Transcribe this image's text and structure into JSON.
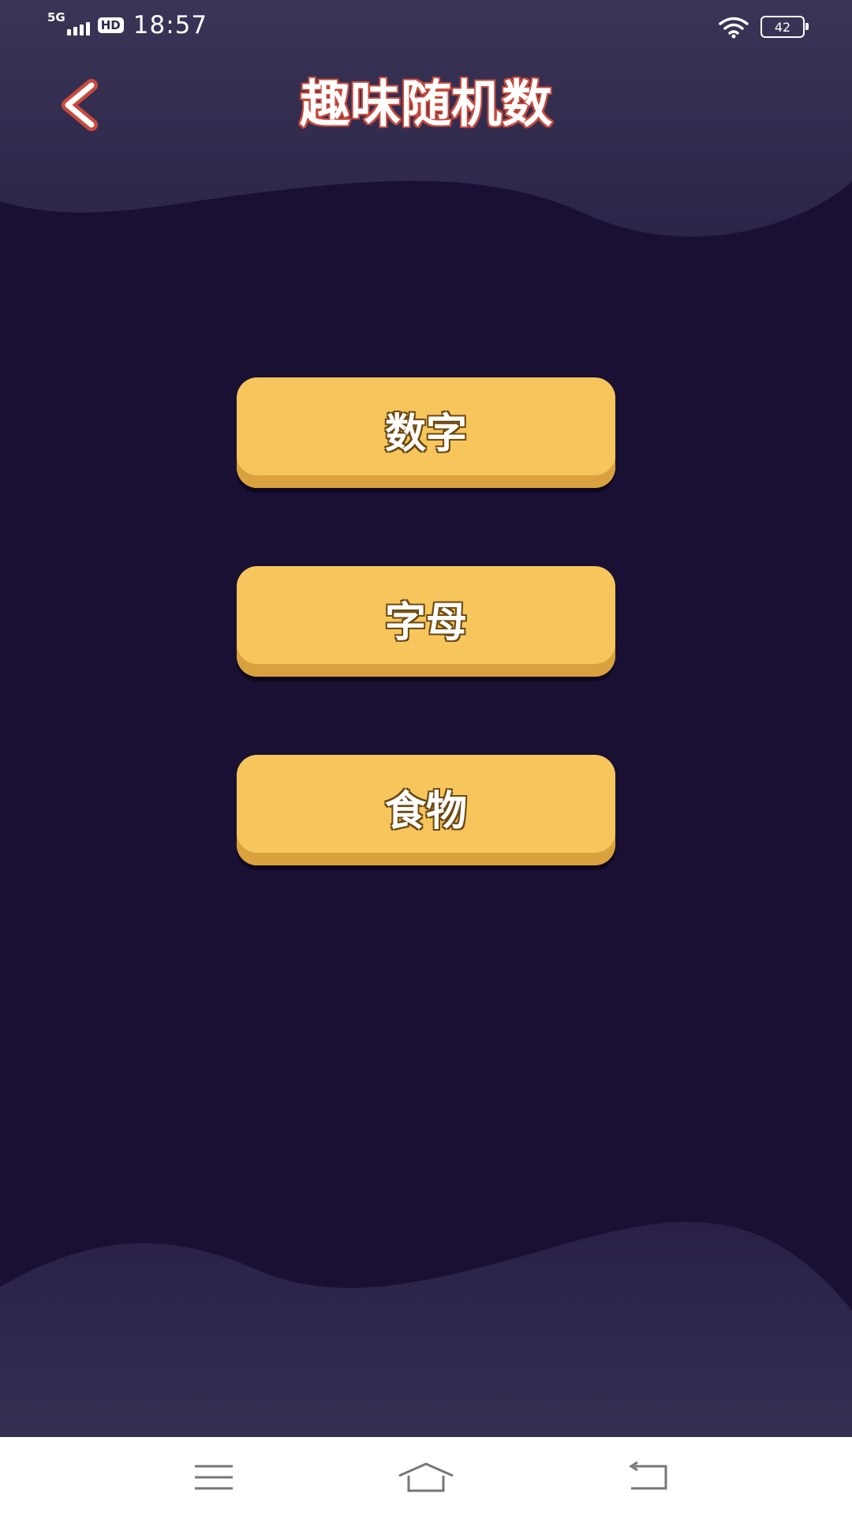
{
  "status_bar": {
    "network": "5G",
    "hd": "HD",
    "time": "18:57",
    "battery": "42"
  },
  "header": {
    "title": "趣味随机数",
    "back_icon": "chevron-left-icon"
  },
  "menu": {
    "items": [
      {
        "label": "数字"
      },
      {
        "label": "字母"
      },
      {
        "label": "食物"
      }
    ]
  },
  "nav_bar": {
    "icons": [
      "menu-icon",
      "home-icon",
      "back-icon"
    ]
  },
  "colors": {
    "background": "#1a1033",
    "wave": "#2f2a4f",
    "button": "#f6c55c",
    "title_stroke": "#c84a3c"
  }
}
